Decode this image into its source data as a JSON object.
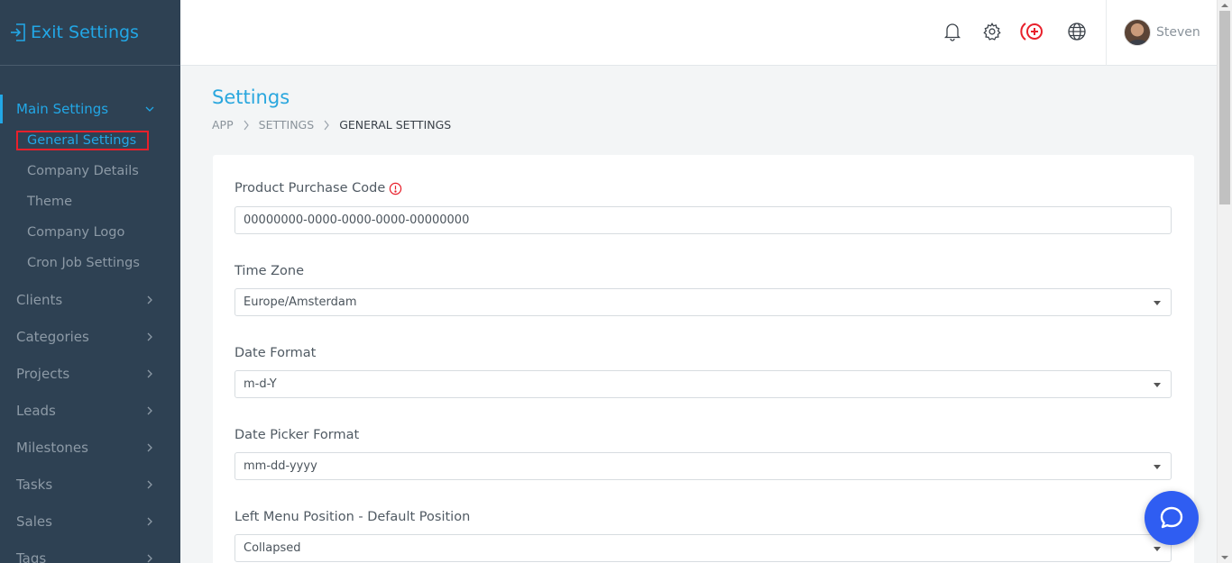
{
  "sidebar": {
    "exit_label": "Exit Settings",
    "main_section": "Main Settings",
    "sub_items": [
      {
        "label": "General Settings"
      },
      {
        "label": "Company Details"
      },
      {
        "label": "Theme"
      },
      {
        "label": "Company Logo"
      },
      {
        "label": "Cron Job Settings"
      }
    ],
    "items": [
      {
        "label": "Clients"
      },
      {
        "label": "Categories"
      },
      {
        "label": "Projects"
      },
      {
        "label": "Leads"
      },
      {
        "label": "Milestones"
      },
      {
        "label": "Tasks"
      },
      {
        "label": "Sales"
      },
      {
        "label": "Tags"
      }
    ]
  },
  "header": {
    "icons": [
      "bell-icon",
      "gear-icon",
      "add-circle-icon",
      "globe-icon"
    ],
    "user_name": "Steven"
  },
  "page": {
    "title": "Settings",
    "breadcrumb": [
      "APP",
      "SETTINGS",
      "GENERAL SETTINGS"
    ]
  },
  "form": {
    "purchase_code_label": "Product Purchase Code",
    "purchase_code_value": "00000000-0000-0000-0000-00000000",
    "timezone_label": "Time Zone",
    "timezone_value": "Europe/Amsterdam",
    "date_format_label": "Date Format",
    "date_format_value": "m-d-Y",
    "date_picker_label": "Date Picker Format",
    "date_picker_value": "mm-dd-yyyy",
    "left_menu_label": "Left Menu Position - Default Position",
    "left_menu_value": "Collapsed"
  },
  "colors": {
    "sidebar_bg": "#2e4153",
    "accent": "#22a7e6",
    "highlight_box": "#e8202b",
    "add_icon": "#e8202b",
    "chat_bubble": "#2f5df2"
  }
}
